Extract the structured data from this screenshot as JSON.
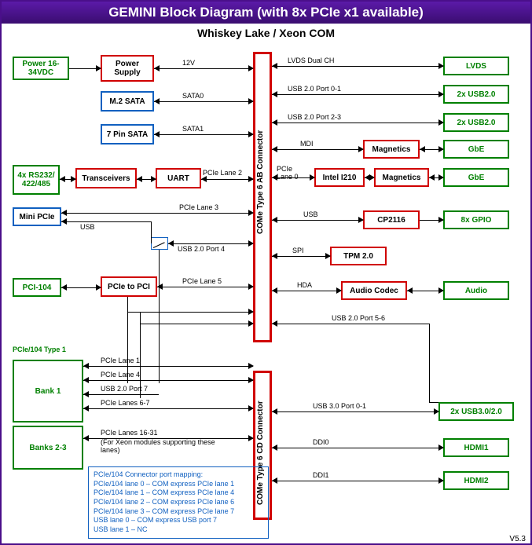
{
  "title": "GEMINI Block Diagram (with 8x PCIe x1 available)",
  "subtitle": "Whiskey Lake / Xeon COM",
  "version": "V5.3",
  "connectors": {
    "ab": "COMe Type 6 AB Connector",
    "cd": "COMe Type 6 CD Connector"
  },
  "left_boxes": {
    "power_ext": "Power 16-34VDC",
    "power_supply": "Power Supply",
    "m2_sata": "M.2 SATA",
    "pin7_sata": "7 Pin SATA",
    "rs232": "4x RS232/ 422/485",
    "transceivers": "Transceivers",
    "uart": "UART",
    "mini_pcie": "Mini PCIe",
    "pci104": "PCI-104",
    "pcie_to_pci": "PCIe to PCI",
    "pcie104_type1": "PCIe/104 Type 1",
    "bank1": "Bank 1",
    "banks23": "Banks 2-3"
  },
  "right_boxes": {
    "lvds": "LVDS",
    "usb20_a": "2x USB2.0",
    "usb20_b": "2x USB2.0",
    "magnetics1": "Magnetics",
    "gbe1": "GbE",
    "i210": "Intel I210",
    "magnetics2": "Magnetics",
    "gbe2": "GbE",
    "cp2116": "CP2116",
    "gpio": "8x GPIO",
    "tpm": "TPM 2.0",
    "audio_codec": "Audio Codec",
    "audio": "Audio",
    "usb30": "2x USB3.0/2.0",
    "hdmi1": "HDMI1",
    "hdmi2": "HDMI2"
  },
  "signals": {
    "v12": "12V",
    "sata0": "SATA0",
    "sata1": "SATA1",
    "pcie2": "PCIe Lane 2",
    "pcie3": "PCIe Lane 3",
    "usb": "USB",
    "usb_p4": "USB 2.0 Port 4",
    "pcie5": "PCIe Lane 5",
    "pcie1": "PCIe Lane 1",
    "pcie4": "PCIe Lane 4",
    "usb_p7": "USB 2.0 Port 7",
    "pcie67": "PCIe Lanes 6-7",
    "pcie1631": "PCIe Lanes 16-31",
    "xeon_note": "(For Xeon modules supporting these lanes)",
    "lvds_d": "LVDS Dual CH",
    "usb_p01": "USB 2.0 Port 0-1",
    "usb_p23": "USB 2.0 Port 2-3",
    "mdi": "MDI",
    "pcie0": "PCIe Lane 0",
    "usb_r": "USB",
    "spi": "SPI",
    "hda": "HDA",
    "usb_p56": "USB 2.0 Port 5-6",
    "usb3_p01": "USB 3.0 Port 0-1",
    "ddi0": "DDI0",
    "ddi1": "DDI1"
  },
  "note": {
    "title": "PCIe/104 Connector port mapping:",
    "l1": "PCIe/104 lane 0 – COM express PCIe lane 1",
    "l2": "PCIe/104 lane 1 – COM express PCIe lane 4",
    "l3": "PCIe/104 lane 2 – COM express PCIe lane 6",
    "l4": "PCIe/104 lane 3 – COM express PCIe lane 7",
    "l5": "USB lane 0 – COM express USB port 7",
    "l6": "USB lane 1 – NC"
  }
}
